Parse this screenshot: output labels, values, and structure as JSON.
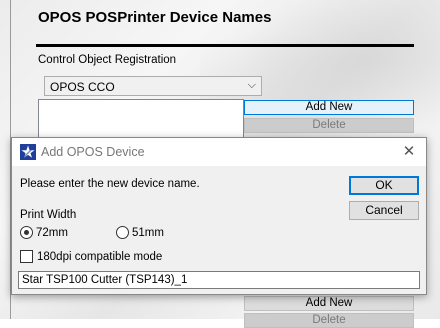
{
  "background_window": {
    "title": "OPOS POSPrinter Device Names",
    "registration_label": "Control Object Registration",
    "combo_value": "OPOS CCO",
    "add_new_label": "Add New",
    "delete_label": "Delete",
    "add_new_label_2": "Add New",
    "delete_label_2": "Delete"
  },
  "dialog": {
    "title": "Add OPOS Device",
    "close_glyph": "✕",
    "prompt": "Please enter the new device name.",
    "ok_label": "OK",
    "cancel_label": "Cancel",
    "print_width_label": "Print Width",
    "radio_options": [
      {
        "label": "72mm",
        "selected": true
      },
      {
        "label": "51mm",
        "selected": false
      }
    ],
    "checkbox": {
      "label": "180dpi compatible mode",
      "checked": false
    },
    "device_name_value": "Star TSP100 Cutter (TSP143)_1"
  },
  "icons": {
    "app_icon": "star-logo-icon",
    "combo_arrow": "chevron-down-icon"
  },
  "colors": {
    "focus_blue": "#0078d7",
    "dialog_bg": "#f0f0f0",
    "logo_blue": "#1f3f9a"
  }
}
